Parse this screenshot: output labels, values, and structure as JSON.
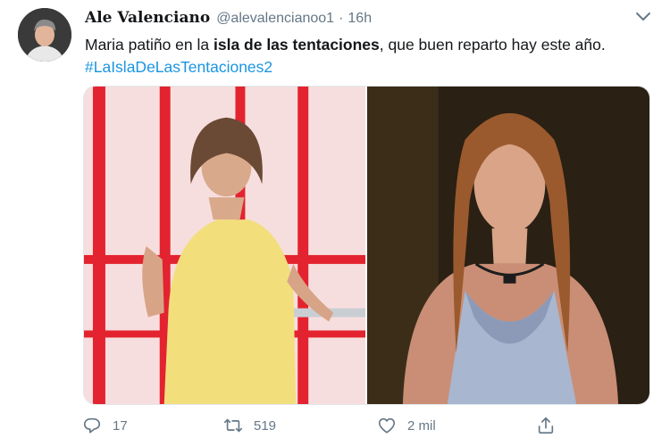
{
  "tweet": {
    "author": {
      "display_name": "Ale Valenciano",
      "handle": "@alevalencianoo1",
      "avatar_icon": "user-avatar"
    },
    "separator": "·",
    "timestamp": "16h",
    "text": {
      "before": "Maria patiño en la ",
      "bold": "isla de las tentaciones",
      "after": ", que buen reparto hay este año."
    },
    "hashtag": "#LaIslaDeLasTentaciones2",
    "media": [
      {
        "kind": "photo",
        "icon": "photo-woman-yellow-dress"
      },
      {
        "kind": "photo",
        "icon": "photo-woman-satin-top"
      }
    ],
    "actions": {
      "reply": {
        "icon": "reply-icon",
        "count": "17"
      },
      "retweet": {
        "icon": "retweet-icon",
        "count": "519"
      },
      "like": {
        "icon": "heart-icon",
        "count": "2 mil"
      },
      "share": {
        "icon": "share-icon",
        "count": ""
      }
    },
    "menu_icon": "chevron-down-icon"
  },
  "colors": {
    "link": "#1b95e0",
    "muted": "#657786",
    "text": "#14171a"
  }
}
